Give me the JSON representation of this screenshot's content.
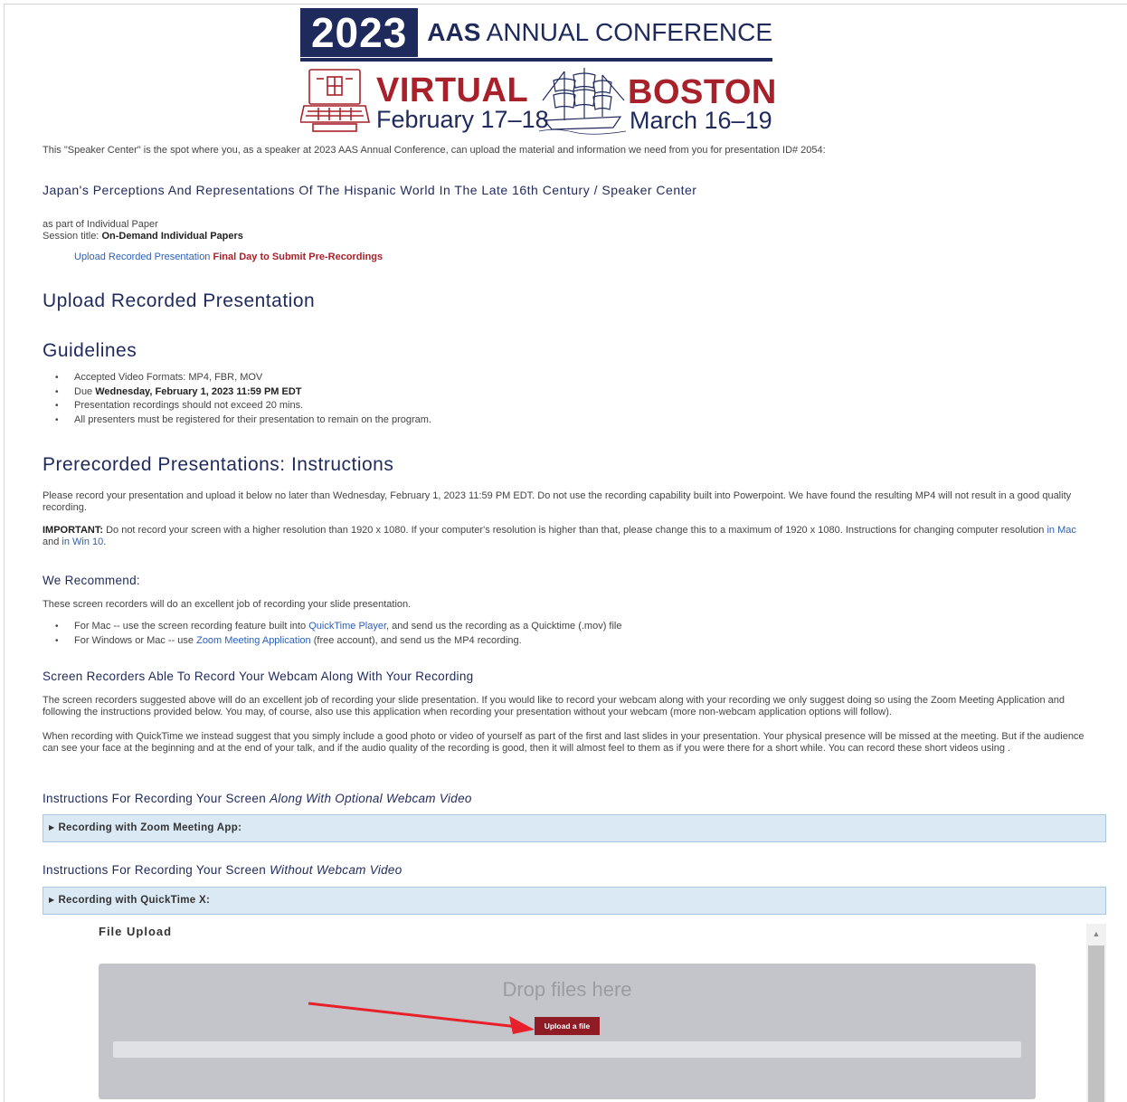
{
  "banner": {
    "year": "2023",
    "conf_bold": "AAS",
    "conf_rest": "ANNUAL CONFERENCE",
    "virtual_title": "VIRTUAL",
    "virtual_date": "February 17–18",
    "boston_title": "BOSTON",
    "boston_date": "March 16–19"
  },
  "intro": "This \"Speaker Center\" is the spot where you, as a speaker at 2023 AAS Annual Conference, can upload the material and information we need from you for presentation ID# 2054:",
  "paper_title": "Japan's Perceptions And Representations Of The Hispanic World In The Late 16th Century / Speaker Center",
  "session": {
    "part_of": "as part of Individual Paper",
    "title_label": "Session title:",
    "title_value": "On-Demand Individual Papers"
  },
  "task_link": {
    "link": "Upload Recorded Presentation",
    "note": "Final Day to Submit Pre-Recordings"
  },
  "h_upload": "Upload Recorded Presentation",
  "h_guidelines": "Guidelines",
  "guidelines": {
    "formats": "Accepted Video Formats: MP4, FBR, MOV",
    "due_label": "Due",
    "due_value": "Wednesday, February 1, 2023 11:59 PM EDT",
    "length": "Presentation recordings should not exceed 20 mins.",
    "registered": "All presenters must be registered for their presentation to remain on the program."
  },
  "h_instructions": "Prerecorded Presentations: Instructions",
  "instructions_p1": "Please record your presentation and upload it below no later than Wednesday, February 1, 2023 11:59 PM EDT. Do not use the recording capability built into Powerpoint. We have found the resulting MP4 will not result in a good quality recording.",
  "important": {
    "label": "IMPORTANT:",
    "text": "Do not record your screen with a higher resolution than 1920 x 1080. If your computer's resolution is higher than that, please change this to a maximum of 1920 x 1080. Instructions for changing computer resolution",
    "in1": "in",
    "mac": "Mac",
    "and": "and",
    "in2": "in",
    "win": "Win 10",
    "dot": "."
  },
  "h_recommend": "We Recommend:",
  "recommend_intro": "These screen recorders will do an excellent job of recording your slide presentation.",
  "recommend": {
    "mac_pre": "For Mac -- use the screen recording feature built into",
    "mac_link": "QuickTime Player",
    "mac_post": ", and send us the recording as a Quicktime (.mov) file",
    "win_pre": "For Windows or Mac -- use",
    "win_link": "Zoom Meeting Application",
    "win_post": "(free account), and send us the MP4 recording."
  },
  "h_webcam": "Screen Recorders Able To Record Your Webcam Along With Your Recording",
  "webcam_p1": "The screen recorders suggested above will do an excellent job of recording your slide presentation. If you would like to record your webcam along with your recording we only suggest doing so using the Zoom Meeting Application and following the instructions provided below. You may, of course, also use this application when recording your presentation without your webcam (more non-webcam application options will follow).",
  "webcam_p2": "When recording with QuickTime we instead suggest that you simply include a good photo or video of yourself as part of the first and last slides in your presentation. Your physical presence will be missed at the meeting. But if the audience can see your face at the beginning and at the end of your talk, and if the audio quality of the recording is good, then it will almost feel to them as if you were there for a short while. You can record these short videos using .",
  "h_along": {
    "pre": "Instructions For Recording Your Screen",
    "em": "Along With Optional Webcam Video"
  },
  "acc_zoom": "Recording with Zoom Meeting App:",
  "h_without": {
    "pre": "Instructions For Recording Your Screen",
    "em": "Without Webcam Video"
  },
  "acc_quicktime": "Recording with QuickTime X:",
  "file_upload": {
    "title": "File Upload",
    "drop": "Drop files here",
    "button": "Upload a file"
  },
  "colors": {
    "navy": "#1f2a5c",
    "brand_red": "#a8202a",
    "link": "#2f5fb3",
    "accordion_bg": "#dbe9f5",
    "button": "#8f1b25"
  }
}
